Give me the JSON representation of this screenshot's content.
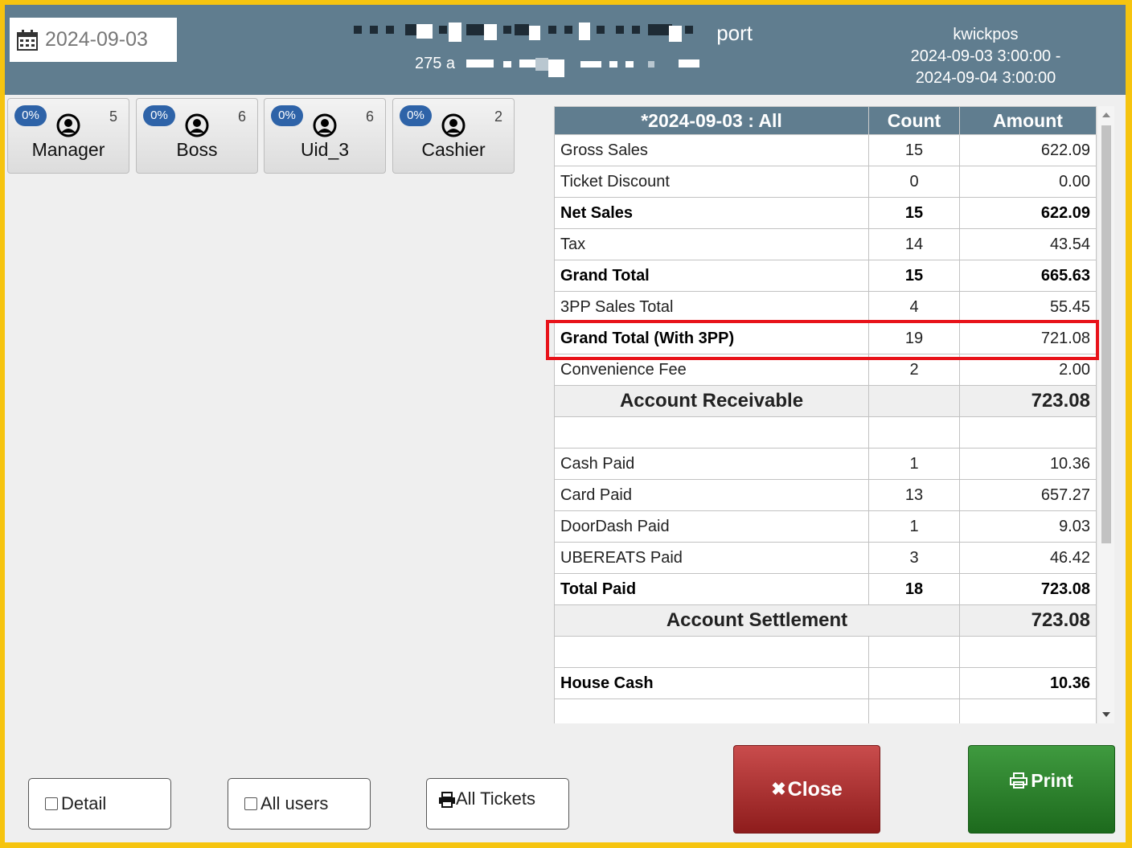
{
  "header": {
    "date": "2024-09-03",
    "title_partial": "port",
    "subtitle_partial": "275 a",
    "user": "kwickpos",
    "range_start": "2024-09-03 3:00:00 -",
    "range_end": "2024-09-04 3:00:00"
  },
  "users": [
    {
      "badge": "0%",
      "count": "5",
      "name": "Manager"
    },
    {
      "badge": "0%",
      "count": "6",
      "name": "Boss"
    },
    {
      "badge": "0%",
      "count": "6",
      "name": "Uid_3"
    },
    {
      "badge": "0%",
      "count": "2",
      "name": "Cashier"
    }
  ],
  "report": {
    "headers": [
      "*2024-09-03 : All",
      "Count",
      "Amount"
    ],
    "rows": [
      {
        "label": "Gross Sales",
        "count": "15",
        "amount": "622.09"
      },
      {
        "label": "Ticket Discount",
        "count": "0",
        "amount": "0.00"
      },
      {
        "label": "Net Sales",
        "count": "15",
        "amount": "622.09"
      },
      {
        "label": "Tax",
        "count": "14",
        "amount": "43.54"
      },
      {
        "label": "Grand Total",
        "count": "15",
        "amount": "665.63"
      },
      {
        "label": "3PP Sales Total",
        "count": "4",
        "amount": "55.45"
      },
      {
        "label": "Grand Total (With 3PP)",
        "count": "19",
        "amount": "721.08"
      },
      {
        "label": "Convenience Fee",
        "count": "2",
        "amount": "2.00"
      },
      {
        "label": "Account Receivable",
        "count": "",
        "amount": "723.08"
      },
      {
        "label": "Cash Paid",
        "count": "1",
        "amount": "10.36"
      },
      {
        "label": "Card Paid",
        "count": "13",
        "amount": "657.27"
      },
      {
        "label": "DoorDash Paid",
        "count": "1",
        "amount": "9.03"
      },
      {
        "label": "UBEREATS Paid",
        "count": "3",
        "amount": "46.42"
      },
      {
        "label": "Total Paid",
        "count": "18",
        "amount": "723.08"
      },
      {
        "label": "Account Settlement",
        "amount": "723.08"
      },
      {
        "label": "House Cash",
        "count": "",
        "amount": "10.36"
      }
    ]
  },
  "buttons": {
    "detail": "Detail",
    "all_users": "All users",
    "all_tickets": "All Tickets",
    "close": "Close",
    "print": "Print"
  },
  "colors": {
    "border": "#f6c40f",
    "header_bg": "#607d8f",
    "badge": "#2e63a8",
    "highlight": "#e8131a",
    "close_button": "#a83030",
    "print_button": "#2e8a2e"
  }
}
